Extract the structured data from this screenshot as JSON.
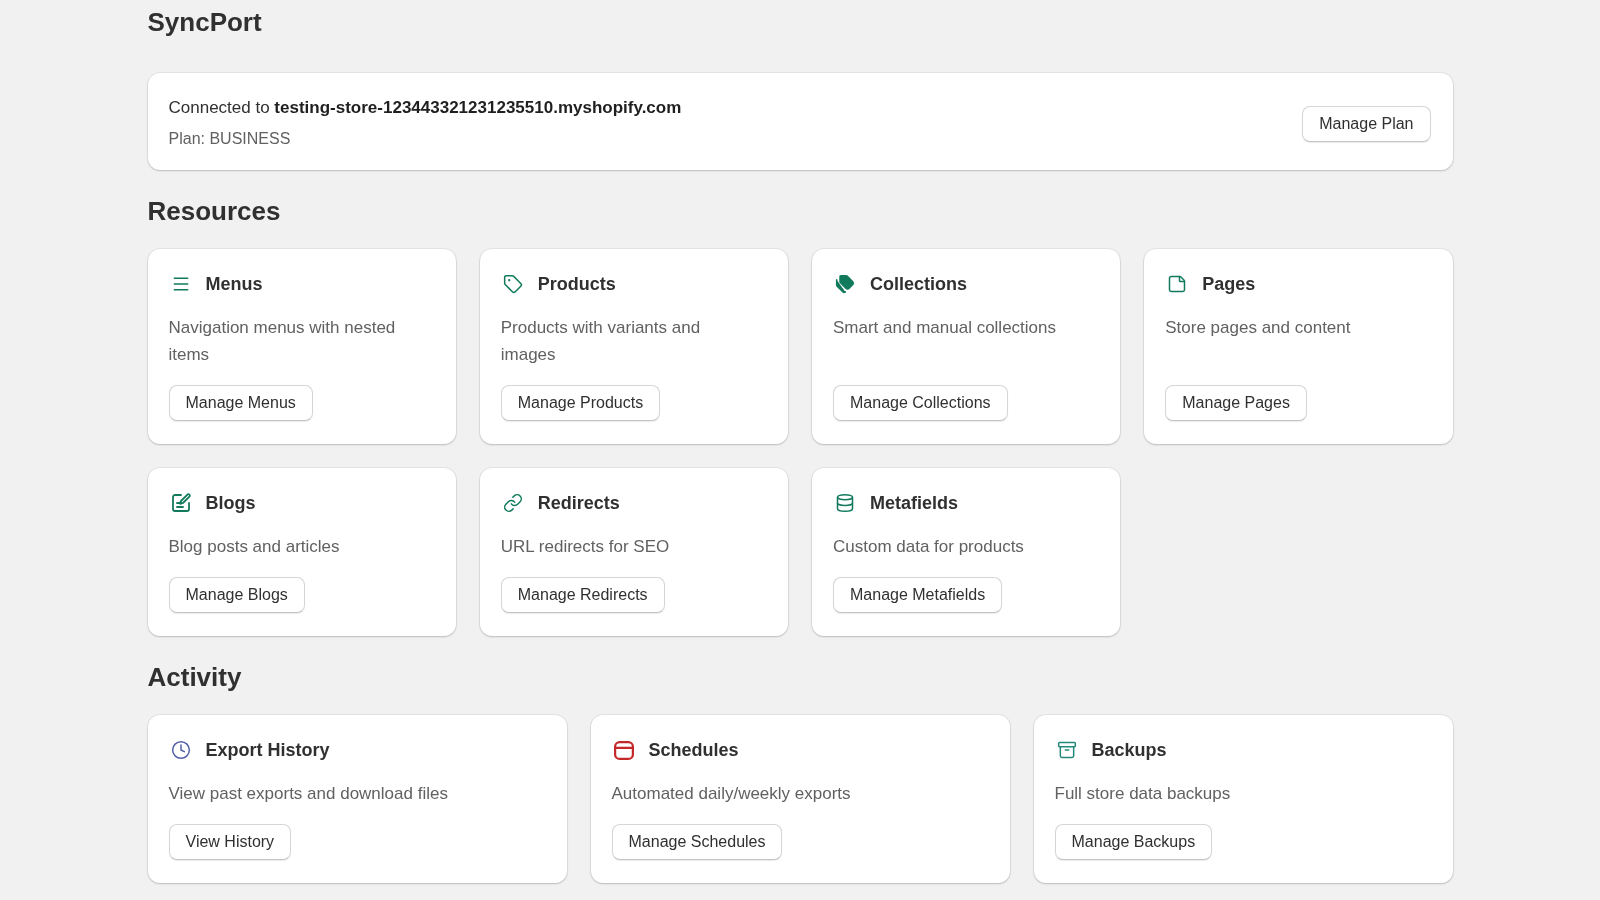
{
  "app": {
    "title": "SyncPort"
  },
  "connection": {
    "status": "Connected to **testing-store-123443321231235510.myshopify.com**",
    "plan": "Plan: BUSINESS",
    "button": "Manage Plan"
  },
  "resources": {
    "heading": "Resources",
    "cards": [
      {
        "title": "Menus",
        "description": "Navigation menus with nested items",
        "button": "Manage Menus"
      },
      {
        "title": "Products",
        "description": "Products with variants and images",
        "button": "Manage Products"
      },
      {
        "title": "Collections",
        "description": "Smart and manual collections",
        "button": "Manage Collections"
      },
      {
        "title": "Pages",
        "description": "Store pages and content",
        "button": "Manage Pages"
      },
      {
        "title": "Blogs",
        "description": "Blog posts and articles",
        "button": "Manage Blogs"
      },
      {
        "title": "Redirects",
        "description": "URL redirects for SEO",
        "button": "Manage Redirects"
      },
      {
        "title": "Metafields",
        "description": "Custom data for products",
        "button": "Manage Metafields"
      }
    ]
  },
  "activity": {
    "heading": "Activity",
    "cards": [
      {
        "title": "Export History",
        "description": "View past exports and download files",
        "button": "View History",
        "color": "#5461a8"
      },
      {
        "title": "Schedules",
        "description": "Automated daily/weekly exports",
        "button": "Manage Schedules",
        "color": "#c4282b"
      },
      {
        "title": "Backups",
        "description": "Full store data backups",
        "button": "Manage Backups",
        "color": "#23897a"
      }
    ]
  }
}
